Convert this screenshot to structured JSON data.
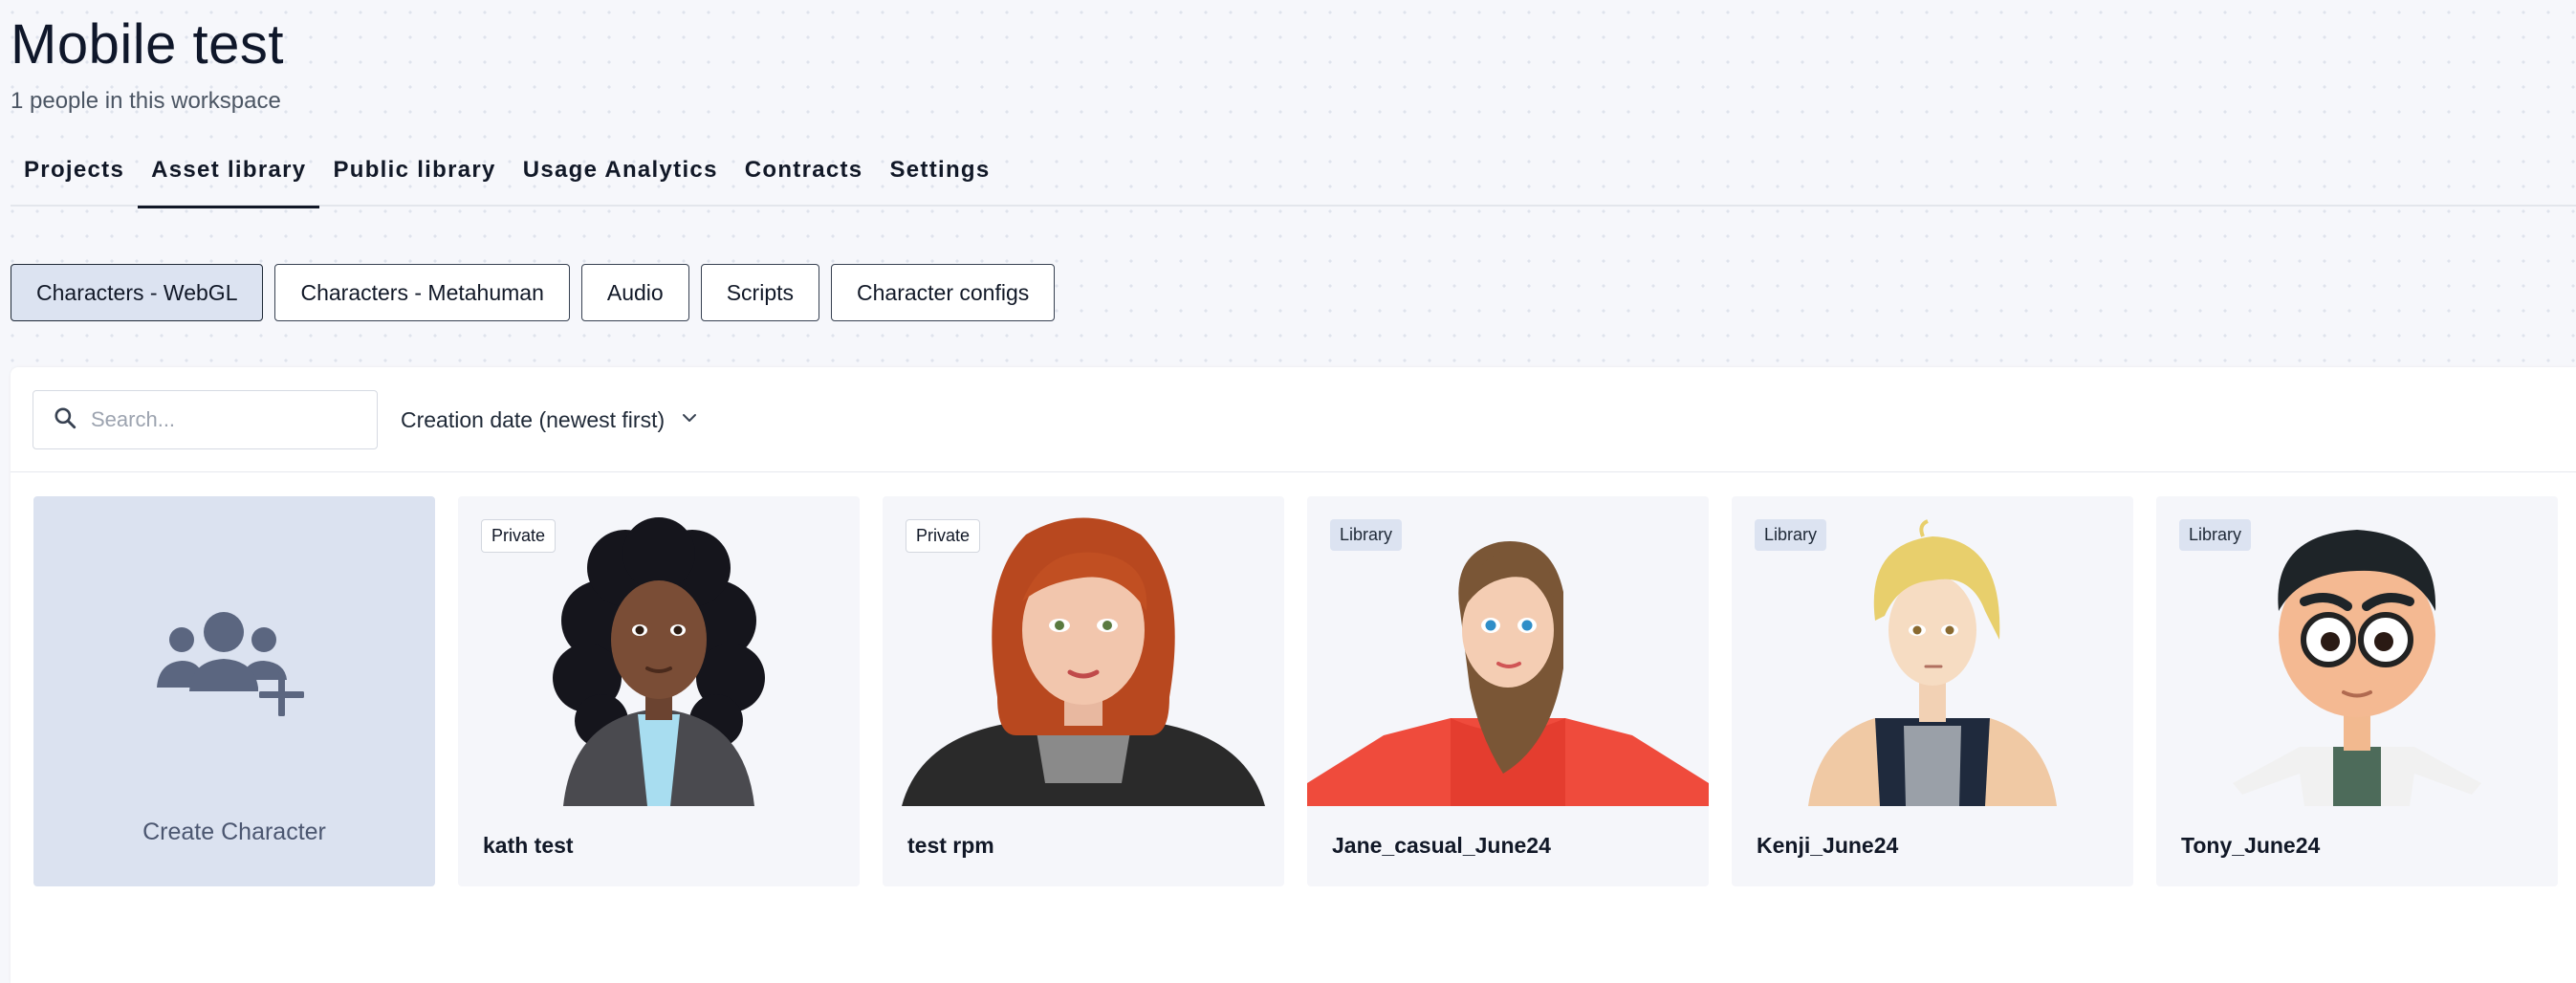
{
  "workspace": {
    "title": "Mobile test",
    "people_count": "1 people in this workspace"
  },
  "tabs": [
    {
      "label": "Projects",
      "active": false
    },
    {
      "label": "Asset library",
      "active": true
    },
    {
      "label": "Public library",
      "active": false
    },
    {
      "label": "Usage Analytics",
      "active": false
    },
    {
      "label": "Contracts",
      "active": false
    },
    {
      "label": "Settings",
      "active": false
    }
  ],
  "asset_types": [
    {
      "label": "Characters - WebGL",
      "active": true
    },
    {
      "label": "Characters - Metahuman",
      "active": false
    },
    {
      "label": "Audio",
      "active": false
    },
    {
      "label": "Scripts",
      "active": false
    },
    {
      "label": "Character configs",
      "active": false
    }
  ],
  "search": {
    "placeholder": "Search...",
    "value": "",
    "icon": "search-icon"
  },
  "sort": {
    "label": "Creation date (newest first)",
    "icon": "chevron-down-icon"
  },
  "create_card": {
    "label": "Create Character",
    "icon": "add-group-icon"
  },
  "characters": [
    {
      "name": "kath test",
      "badge": "Private",
      "badge_type": "private",
      "avatar": "avatar-kath"
    },
    {
      "name": "test rpm",
      "badge": "Private",
      "badge_type": "private",
      "avatar": "avatar-redhead"
    },
    {
      "name": "Jane_casual_June24",
      "badge": "Library",
      "badge_type": "library",
      "avatar": "avatar-jane"
    },
    {
      "name": "Kenji_June24",
      "badge": "Library",
      "badge_type": "library",
      "avatar": "avatar-kenji"
    },
    {
      "name": "Tony_June24",
      "badge": "Library",
      "badge_type": "library",
      "avatar": "avatar-tony"
    }
  ],
  "colors": {
    "accent": "#dce3f1",
    "text": "#111827",
    "create_bg": "#dbe2f0",
    "create_icon": "#5b6680"
  }
}
